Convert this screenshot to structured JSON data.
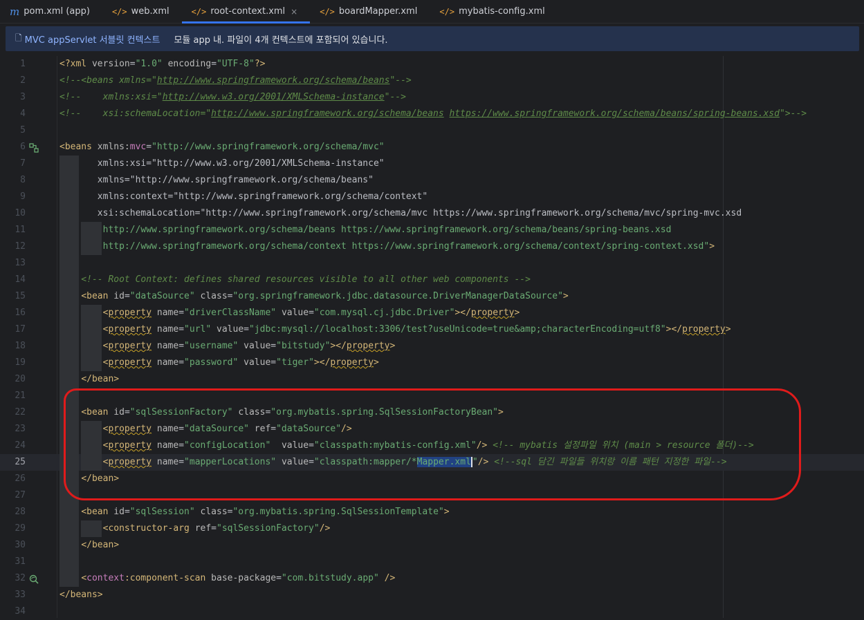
{
  "tabs": [
    {
      "label": "pom.xml (app)",
      "icon": "maven-icon",
      "active": false
    },
    {
      "label": "web.xml",
      "icon": "xml-file-icon",
      "active": false
    },
    {
      "label": "root-context.xml",
      "icon": "xml-file-icon",
      "active": true
    },
    {
      "label": "boardMapper.xml",
      "icon": "xml-file-icon",
      "active": false
    },
    {
      "label": "mybatis-config.xml",
      "icon": "xml-file-icon",
      "active": false
    }
  ],
  "tab_close_glyph": "×",
  "banner": {
    "link": "MVC appServlet 서블릿 컨텍스트",
    "message": "모듈 app 내. 파일이 4개 컨텍스트에 포함되어 있습니다."
  },
  "editor": {
    "current_line": 25,
    "lines": [
      {
        "n": "1",
        "text": "<?xml version=\"1.0\" encoding=\"UTF-8\"?>"
      },
      {
        "n": "2",
        "text": "<!--<beans xmlns=\"http://www.springframework.org/schema/beans\"-->"
      },
      {
        "n": "3",
        "text": "<!--    xmlns:xsi=\"http://www.w3.org/2001/XMLSchema-instance\"-->"
      },
      {
        "n": "4",
        "text": "<!--    xsi:schemaLocation=\"http://www.springframework.org/schema/beans https://www.springframework.org/schema/beans/spring-beans.xsd\">-->"
      },
      {
        "n": "5",
        "text": ""
      },
      {
        "n": "6",
        "text": "<beans xmlns:mvc=\"http://www.springframework.org/schema/mvc\""
      },
      {
        "n": "7",
        "text": "       xmlns:xsi=\"http://www.w3.org/2001/XMLSchema-instance\""
      },
      {
        "n": "8",
        "text": "       xmlns=\"http://www.springframework.org/schema/beans\""
      },
      {
        "n": "9",
        "text": "       xmlns:context=\"http://www.springframework.org/schema/context\""
      },
      {
        "n": "10",
        "text": "       xsi:schemaLocation=\"http://www.springframework.org/schema/mvc https://www.springframework.org/schema/mvc/spring-mvc.xsd"
      },
      {
        "n": "11",
        "text": "        http://www.springframework.org/schema/beans https://www.springframework.org/schema/beans/spring-beans.xsd"
      },
      {
        "n": "12",
        "text": "        http://www.springframework.org/schema/context https://www.springframework.org/schema/context/spring-context.xsd\">"
      },
      {
        "n": "13",
        "text": ""
      },
      {
        "n": "14",
        "text": "    <!-- Root Context: defines shared resources visible to all other web components -->"
      },
      {
        "n": "15",
        "text": "    <bean id=\"dataSource\" class=\"org.springframework.jdbc.datasource.DriverManagerDataSource\">"
      },
      {
        "n": "16",
        "text": "        <property name=\"driverClassName\" value=\"com.mysql.cj.jdbc.Driver\"></property>"
      },
      {
        "n": "17",
        "text": "        <property name=\"url\" value=\"jdbc:mysql://localhost:3306/test?useUnicode=true&amp;characterEncoding=utf8\"></property>"
      },
      {
        "n": "18",
        "text": "        <property name=\"username\" value=\"bitstudy\"></property>"
      },
      {
        "n": "19",
        "text": "        <property name=\"password\" value=\"tiger\"></property>"
      },
      {
        "n": "20",
        "text": "    </bean>"
      },
      {
        "n": "21",
        "text": ""
      },
      {
        "n": "22",
        "text": "    <bean id=\"sqlSessionFactory\" class=\"org.mybatis.spring.SqlSessionFactoryBean\">"
      },
      {
        "n": "23",
        "text": "        <property name=\"dataSource\" ref=\"dataSource\"/>"
      },
      {
        "n": "24",
        "text": "        <property name=\"configLocation\"  value=\"classpath:mybatis-config.xml\"/> <!-- mybatis 설정파일 위치 (main > resource 폴더)-->"
      },
      {
        "n": "25",
        "text": "        <property name=\"mapperLocations\" value=\"classpath:mapper/*Mapper.xml\"/> <!--sql 담긴 파일들 위치랑 이름 패턴 지정한 파일-->"
      },
      {
        "n": "26",
        "text": "    </bean>"
      },
      {
        "n": "27",
        "text": ""
      },
      {
        "n": "28",
        "text": "    <bean id=\"sqlSession\" class=\"org.mybatis.spring.SqlSessionTemplate\">"
      },
      {
        "n": "29",
        "text": "        <constructor-arg ref=\"sqlSessionFactory\"/>"
      },
      {
        "n": "30",
        "text": "    </bean>"
      },
      {
        "n": "31",
        "text": ""
      },
      {
        "n": "32",
        "text": "    <context:component-scan base-package=\"com.bitstudy.app\" />"
      },
      {
        "n": "33",
        "text": "</beans>"
      },
      {
        "n": "34",
        "text": ""
      }
    ]
  },
  "colors": {
    "tag": "#d5b778",
    "attr": "#bababa",
    "namespace": "#c77dbb",
    "string": "#6aab73",
    "comment": "#7a7e85",
    "comment_green": "#5f8c49",
    "accent": "#3574f0",
    "annotation": "#e01b1b"
  }
}
